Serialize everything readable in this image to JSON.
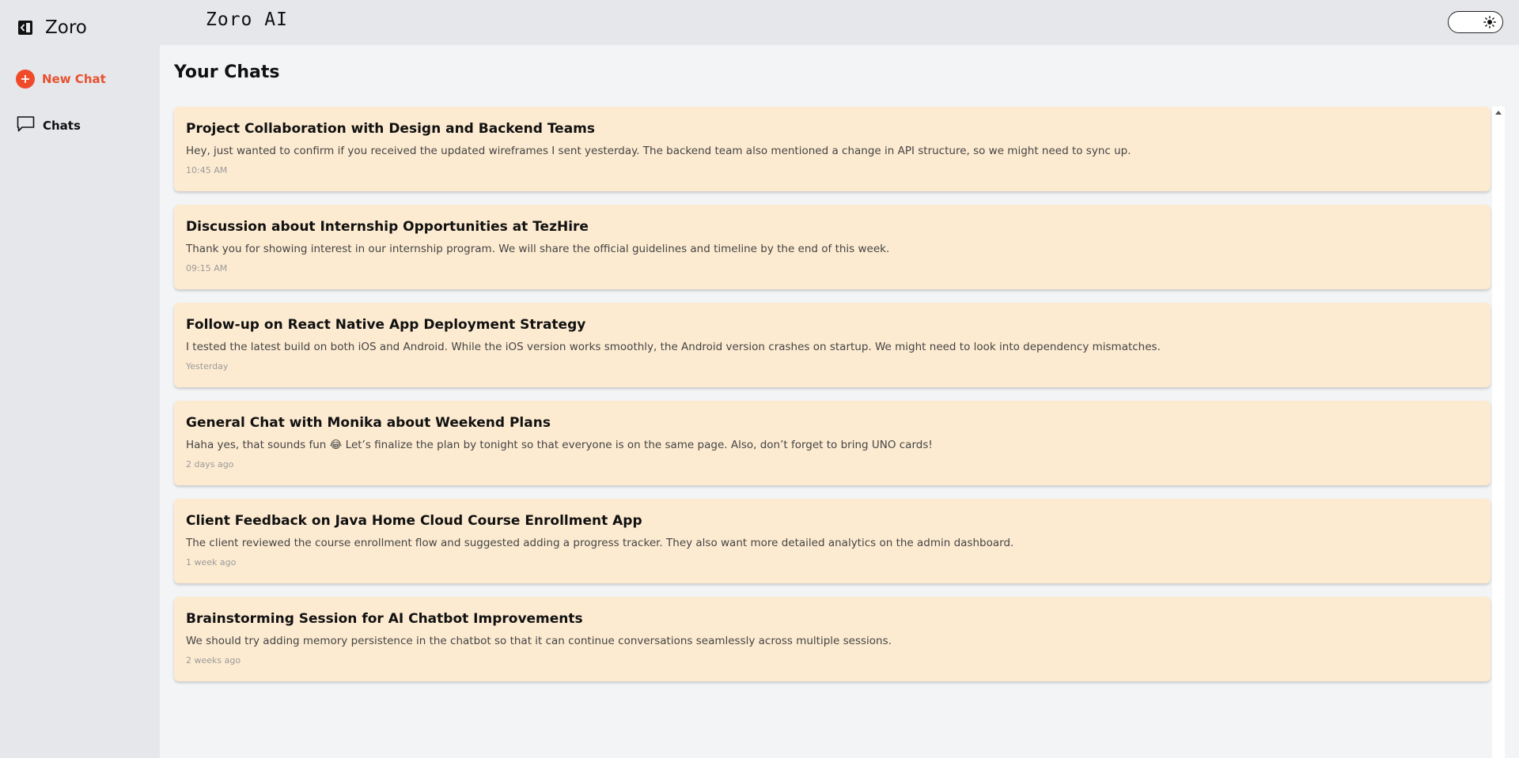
{
  "sidebar": {
    "brand": "Zoro",
    "new_chat": "New Chat",
    "chats": "Chats"
  },
  "header": {
    "title": "Zoro AI",
    "theme_icon": "sun-icon"
  },
  "main": {
    "heading": "Your Chats",
    "chats": [
      {
        "title": "Project Collaboration with Design and Backend Teams",
        "preview": "Hey, just wanted to confirm if you received the updated wireframes I sent yesterday. The backend team also mentioned a change in API structure, so we might need to sync up.",
        "time": "10:45 AM"
      },
      {
        "title": "Discussion about Internship Opportunities at TezHire",
        "preview": "Thank you for showing interest in our internship program. We will share the official guidelines and timeline by the end of this week.",
        "time": "09:15 AM"
      },
      {
        "title": "Follow-up on React Native App Deployment Strategy",
        "preview": "I tested the latest build on both iOS and Android. While the iOS version works smoothly, the Android version crashes on startup. We might need to look into dependency mismatches.",
        "time": "Yesterday"
      },
      {
        "title": "General Chat with Monika about Weekend Plans",
        "preview": "Haha yes, that sounds fun 😂 Let’s finalize the plan by tonight so that everyone is on the same page. Also, don’t forget to bring UNO cards!",
        "time": "2 days ago"
      },
      {
        "title": "Client Feedback on Java Home Cloud Course Enrollment App",
        "preview": "The client reviewed the course enrollment flow and suggested adding a progress tracker. They also want more detailed analytics on the admin dashboard.",
        "time": "1 week ago"
      },
      {
        "title": "Brainstorming Session for AI Chatbot Improvements",
        "preview": "We should try adding memory persistence in the chatbot so that it can continue conversations seamlessly across multiple sessions.",
        "time": "2 weeks ago"
      }
    ]
  },
  "colors": {
    "accent": "#f04a2a",
    "card_bg": "#fdebd1",
    "sidebar_bg": "#e5e7eb",
    "main_bg": "#f3f4f6"
  }
}
